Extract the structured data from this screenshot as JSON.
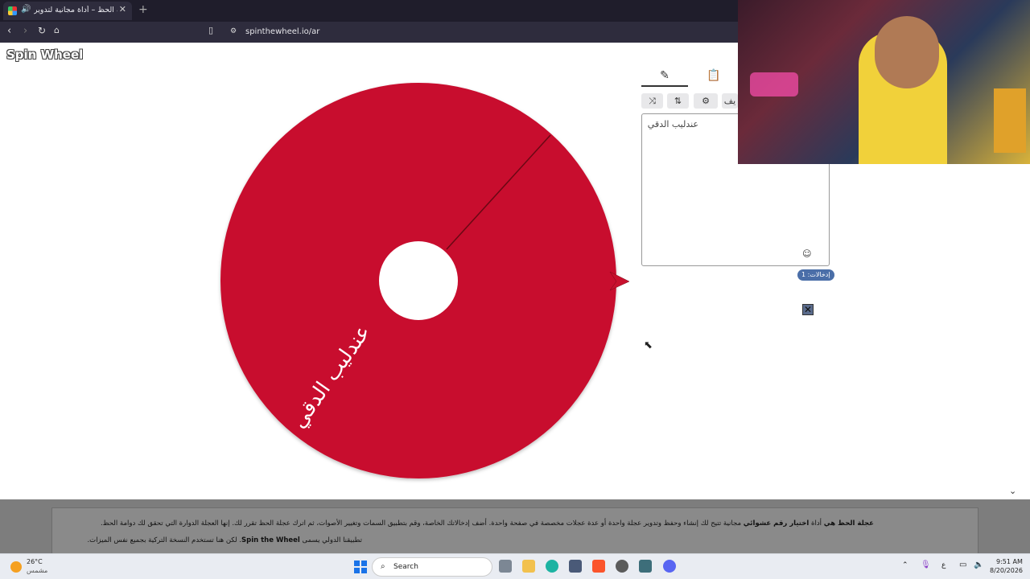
{
  "browser": {
    "tab_title": "عجلة الحظ – أداة مجانية لتدوير",
    "tab_close": "✕",
    "new_tab": "+",
    "url": "spinthewheel.io/ar"
  },
  "site": {
    "logo": "Spin Wheel"
  },
  "wheel": {
    "segment_label": "عندليب الدقي",
    "colors": {
      "segment": "#c8102e",
      "pointer": "#c8102e"
    }
  },
  "panel": {
    "toolbar_clipped_label": "يف",
    "entries_text": "عندليب الدقي",
    "entries_count": "إدخالات: 1"
  },
  "footer": {
    "line1_bold_start": "عجلة الحظ هي",
    "line1_mid": " أداة ",
    "line1_bold_mid": "اختيار رقم عشوائي",
    "line1_rest": " مجانية تتيح لك إنشاء وحفظ وتدوير عجلة واحدة أو عدة عجلات مخصصة في صفحة واحدة. أضف إدخالاتك الخاصة، وقم بتطبيق السمات وتغيير الأصوات، ثم اترك عجلة الحظ تقرر لك. إنها العجلة الدوارة التي تحقق لك دوامة الحظ.",
    "line2_start": "تطبيقنا الدولي يسمى ",
    "line2_bold": "Spin the Wheel",
    "line2_rest": ". لكن هنا تستخدم النسخة التركية بجميع نفس الميزات."
  },
  "taskbar": {
    "weather_temp": "26°C",
    "weather_label": "مشمس",
    "search_label": "Search",
    "lang": "ع",
    "time": "9:51 AM",
    "date": "8/20/2026"
  }
}
